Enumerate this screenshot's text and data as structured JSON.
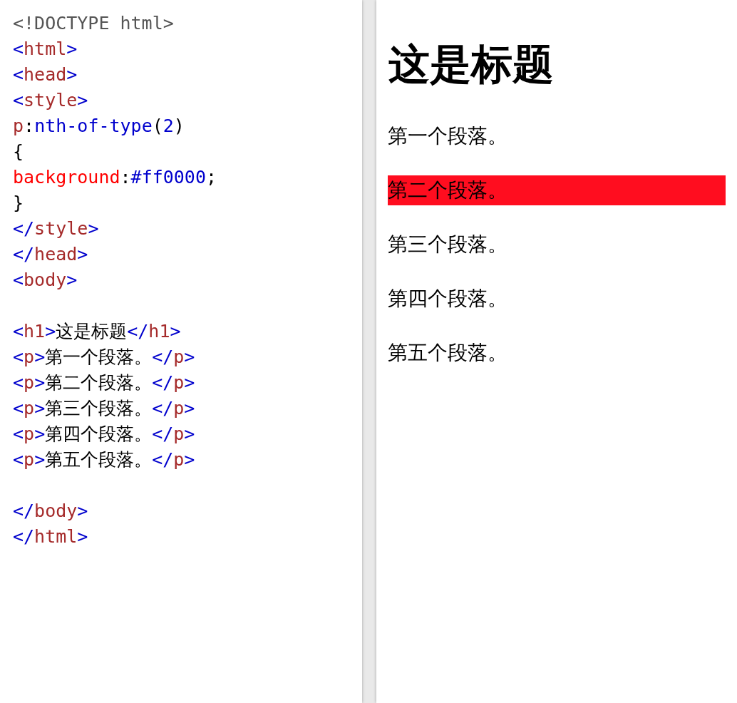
{
  "code_editor": {
    "lines": [
      {
        "kind": "code",
        "tokens": [
          {
            "kind": "doctype",
            "text": "<!DOCTYPE html>"
          }
        ]
      },
      {
        "kind": "code",
        "tokens": [
          {
            "kind": "punct",
            "text": "<"
          },
          {
            "kind": "tag",
            "text": "html"
          },
          {
            "kind": "punct",
            "text": ">"
          }
        ]
      },
      {
        "kind": "code",
        "tokens": [
          {
            "kind": "punct",
            "text": "<"
          },
          {
            "kind": "tag",
            "text": "head"
          },
          {
            "kind": "punct",
            "text": ">"
          }
        ]
      },
      {
        "kind": "code",
        "tokens": [
          {
            "kind": "punct",
            "text": "<"
          },
          {
            "kind": "tag",
            "text": "style"
          },
          {
            "kind": "punct",
            "text": ">"
          }
        ]
      },
      {
        "kind": "code",
        "tokens": [
          {
            "kind": "tag",
            "text": "p"
          },
          {
            "kind": "plain",
            "text": ":"
          },
          {
            "kind": "punct",
            "text": "nth-of-type"
          },
          {
            "kind": "plain",
            "text": "("
          },
          {
            "kind": "punct",
            "text": "2"
          },
          {
            "kind": "plain",
            "text": ")"
          }
        ]
      },
      {
        "kind": "code",
        "tokens": [
          {
            "kind": "plain",
            "text": "{"
          }
        ]
      },
      {
        "kind": "code",
        "tokens": [
          {
            "kind": "property",
            "text": "background"
          },
          {
            "kind": "plain",
            "text": ":"
          },
          {
            "kind": "punct",
            "text": "#ff0000"
          },
          {
            "kind": "plain",
            "text": ";"
          }
        ]
      },
      {
        "kind": "code",
        "tokens": [
          {
            "kind": "plain",
            "text": "}"
          }
        ]
      },
      {
        "kind": "code",
        "tokens": [
          {
            "kind": "punct",
            "text": "</"
          },
          {
            "kind": "tag",
            "text": "style"
          },
          {
            "kind": "punct",
            "text": ">"
          }
        ]
      },
      {
        "kind": "code",
        "tokens": [
          {
            "kind": "punct",
            "text": "</"
          },
          {
            "kind": "tag",
            "text": "head"
          },
          {
            "kind": "punct",
            "text": ">"
          }
        ]
      },
      {
        "kind": "code",
        "tokens": [
          {
            "kind": "punct",
            "text": "<"
          },
          {
            "kind": "tag",
            "text": "body"
          },
          {
            "kind": "punct",
            "text": ">"
          }
        ]
      },
      {
        "kind": "blank"
      },
      {
        "kind": "code",
        "tokens": [
          {
            "kind": "punct",
            "text": "<"
          },
          {
            "kind": "tag",
            "text": "h1"
          },
          {
            "kind": "punct",
            "text": ">"
          },
          {
            "kind": "plain",
            "text": "这是标题"
          },
          {
            "kind": "punct",
            "text": "</"
          },
          {
            "kind": "tag",
            "text": "h1"
          },
          {
            "kind": "punct",
            "text": ">"
          }
        ]
      },
      {
        "kind": "code",
        "tokens": [
          {
            "kind": "punct",
            "text": "<"
          },
          {
            "kind": "tag",
            "text": "p"
          },
          {
            "kind": "punct",
            "text": ">"
          },
          {
            "kind": "plain",
            "text": "第一个段落。"
          },
          {
            "kind": "punct",
            "text": "</"
          },
          {
            "kind": "tag",
            "text": "p"
          },
          {
            "kind": "punct",
            "text": ">"
          }
        ]
      },
      {
        "kind": "code",
        "tokens": [
          {
            "kind": "punct",
            "text": "<"
          },
          {
            "kind": "tag",
            "text": "p"
          },
          {
            "kind": "punct",
            "text": ">"
          },
          {
            "kind": "plain",
            "text": "第二个段落。"
          },
          {
            "kind": "punct",
            "text": "</"
          },
          {
            "kind": "tag",
            "text": "p"
          },
          {
            "kind": "punct",
            "text": ">"
          }
        ]
      },
      {
        "kind": "code",
        "tokens": [
          {
            "kind": "punct",
            "text": "<"
          },
          {
            "kind": "tag",
            "text": "p"
          },
          {
            "kind": "punct",
            "text": ">"
          },
          {
            "kind": "plain",
            "text": "第三个段落。"
          },
          {
            "kind": "punct",
            "text": "</"
          },
          {
            "kind": "tag",
            "text": "p"
          },
          {
            "kind": "punct",
            "text": ">"
          }
        ]
      },
      {
        "kind": "code",
        "tokens": [
          {
            "kind": "punct",
            "text": "<"
          },
          {
            "kind": "tag",
            "text": "p"
          },
          {
            "kind": "punct",
            "text": ">"
          },
          {
            "kind": "plain",
            "text": "第四个段落。"
          },
          {
            "kind": "punct",
            "text": "</"
          },
          {
            "kind": "tag",
            "text": "p"
          },
          {
            "kind": "punct",
            "text": ">"
          }
        ]
      },
      {
        "kind": "code",
        "tokens": [
          {
            "kind": "punct",
            "text": "<"
          },
          {
            "kind": "tag",
            "text": "p"
          },
          {
            "kind": "punct",
            "text": ">"
          },
          {
            "kind": "plain",
            "text": "第五个段落。"
          },
          {
            "kind": "punct",
            "text": "</"
          },
          {
            "kind": "tag",
            "text": "p"
          },
          {
            "kind": "punct",
            "text": ">"
          }
        ]
      },
      {
        "kind": "blank"
      },
      {
        "kind": "code",
        "tokens": [
          {
            "kind": "punct",
            "text": "</"
          },
          {
            "kind": "tag",
            "text": "body"
          },
          {
            "kind": "punct",
            "text": ">"
          }
        ]
      },
      {
        "kind": "code",
        "tokens": [
          {
            "kind": "punct",
            "text": "</"
          },
          {
            "kind": "tag",
            "text": "html"
          },
          {
            "kind": "punct",
            "text": ">"
          }
        ]
      }
    ]
  },
  "preview": {
    "heading": "这是标题",
    "paragraphs": [
      {
        "text": "第一个段落。",
        "highlighted": false
      },
      {
        "text": "第二个段落。",
        "highlighted": true
      },
      {
        "text": "第三个段落。",
        "highlighted": false
      },
      {
        "text": "第四个段落。",
        "highlighted": false
      },
      {
        "text": "第五个段落。",
        "highlighted": false
      }
    ]
  }
}
